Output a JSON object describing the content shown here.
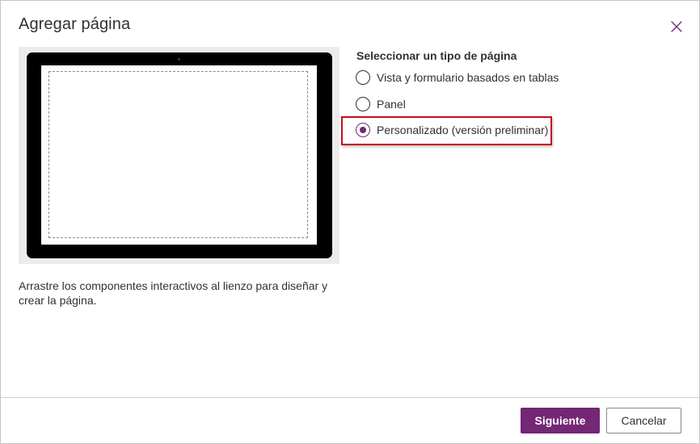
{
  "dialog": {
    "title": "Agregar página",
    "close_icon": "close-icon"
  },
  "preview": {
    "description": "Arrastre los componentes interactivos al lienzo para diseñar y crear la página."
  },
  "page_type": {
    "label": "Seleccionar un tipo de página",
    "options": [
      {
        "label": "Vista y formulario basados en tablas",
        "selected": false
      },
      {
        "label": "Panel",
        "selected": false
      },
      {
        "label": "Personalizado (versión preliminar)",
        "selected": true
      }
    ]
  },
  "footer": {
    "next_label": "Siguiente",
    "cancel_label": "Cancelar"
  },
  "colors": {
    "accent": "#742774",
    "highlight": "#c50f1f",
    "text": "#323130"
  }
}
